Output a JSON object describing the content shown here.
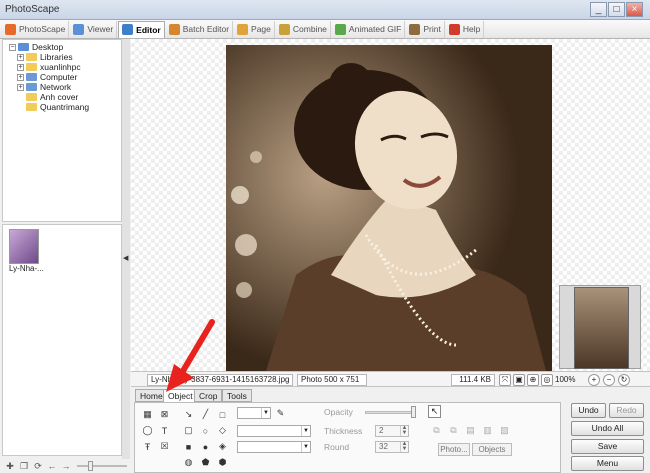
{
  "window": {
    "title": "PhotoScape",
    "min": "_",
    "max": "□",
    "close": "×"
  },
  "tabs": [
    {
      "label": "PhotoScape",
      "icon": "photoscape-icon",
      "color": "#e86a2a"
    },
    {
      "label": "Viewer",
      "icon": "viewer-icon",
      "color": "#5b8fd6"
    },
    {
      "label": "Editor",
      "icon": "editor-icon",
      "color": "#3f7ec8",
      "active": true
    },
    {
      "label": "Batch Editor",
      "icon": "batch-editor-icon",
      "color": "#d4872c"
    },
    {
      "label": "Page",
      "icon": "page-icon",
      "color": "#e0a23a"
    },
    {
      "label": "Combine",
      "icon": "combine-icon",
      "color": "#c9a13a"
    },
    {
      "label": "Animated GIF",
      "icon": "animated-gif-icon",
      "color": "#59a84b"
    },
    {
      "label": "Print",
      "icon": "print-icon",
      "color": "#8e6c3d"
    },
    {
      "label": "Help",
      "icon": "help-icon",
      "color": "#d23a2a"
    }
  ],
  "tree": {
    "root": "Desktop",
    "items": [
      {
        "label": "Libraries",
        "expand": "+",
        "color": "#f2cc5b"
      },
      {
        "label": "xuanlinhpc",
        "expand": "+",
        "color": "#f2cc5b"
      },
      {
        "label": "Computer",
        "expand": "+",
        "color": "#6b9ad6"
      },
      {
        "label": "Network",
        "expand": "+",
        "color": "#6b9ad6"
      },
      {
        "label": "Anh cover",
        "expand": "",
        "color": "#f2cc5b"
      },
      {
        "label": "Quantrimang",
        "expand": "",
        "color": "#f2cc5b"
      }
    ]
  },
  "thumbnail": {
    "label": "Ly-Nha-..."
  },
  "status": {
    "filename": "Ly-Nha-Ky-3837-6931-1415163728.jpg",
    "photo_size": "Photo 500 x 751",
    "filesize": "111.4 KB",
    "zoom": "100%"
  },
  "bottom_tabs": [
    "Home",
    "Object",
    "Crop",
    "Tools"
  ],
  "object_panel": {
    "opacity_label": "Opacity",
    "thickness_label": "Thickness",
    "thickness_value": "2",
    "round_label": "Round",
    "round_value": "32",
    "photo_button": "Photo...",
    "objects_button": "Objects"
  },
  "actions": {
    "undo": "Undo",
    "redo": "Redo",
    "undo_all": "Undo All",
    "save": "Save",
    "menu": "Menu"
  }
}
